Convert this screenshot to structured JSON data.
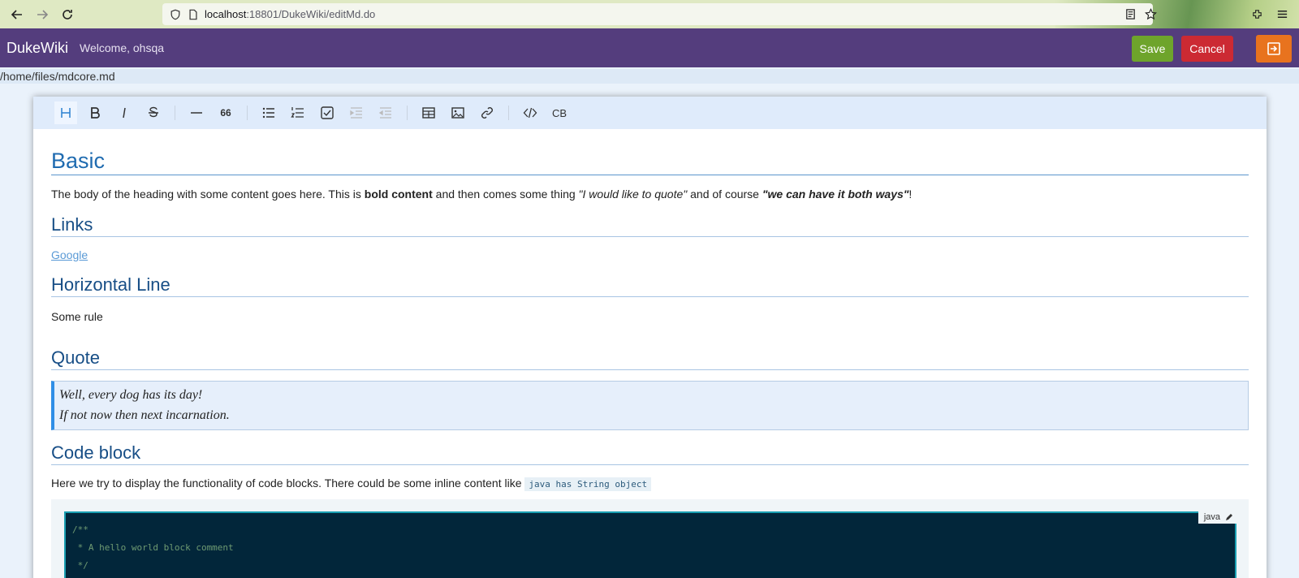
{
  "browser": {
    "url_host": "localhost",
    "url_path": ":18801/DukeWiki/editMd.do",
    "back_icon": "back-arrow-icon",
    "forward_icon": "forward-arrow-icon",
    "reload_icon": "reload-icon"
  },
  "header": {
    "brand": "DukeWiki",
    "welcome": "Welcome, ohsqa",
    "save_label": "Save",
    "cancel_label": "Cancel",
    "colors": {
      "header_bg": "#543d7d",
      "save": "#6ea42b",
      "cancel": "#cc2a33",
      "logout": "#e8731e"
    }
  },
  "file_path": "/home/files/mdcore.md",
  "toolbar": {
    "buttons": [
      "heading",
      "bold",
      "italic",
      "strikethrough",
      "horizontal-rule",
      "quote",
      "bullet-list",
      "ordered-list",
      "task-list",
      "indent",
      "outdent",
      "table",
      "image",
      "link",
      "code",
      "code-block"
    ],
    "code_block_label": "CB",
    "quote_label": "66"
  },
  "document": {
    "basic_heading": "Basic",
    "basic_body_1": "The body of the heading with some content goes here. This is ",
    "basic_bold": "bold content",
    "basic_body_2": " and then comes some thing ",
    "basic_quote_1": "\"I would like to quote\"",
    "basic_body_3": " and of course ",
    "basic_quote_2": "\"we can have it both ways\"",
    "basic_body_4": "!",
    "links_heading": "Links",
    "link_text": "Google",
    "hr_heading": "Horizontal Line",
    "hr_body": "Some rule",
    "quote_heading": "Quote",
    "quote_line_1": "Well, every dog has its day!",
    "quote_line_2": "If not now then next incarnation.",
    "code_heading": "Code block",
    "code_body": "Here we try to display the functionality of code blocks. There could be some inline content like",
    "inline_code": "java has String object",
    "code_lang": "java",
    "code_lines": [
      "/**",
      " * A hello world block comment",
      " */"
    ]
  }
}
